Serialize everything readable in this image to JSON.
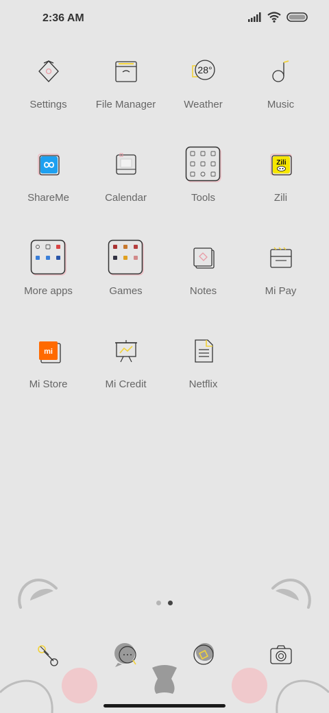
{
  "status_bar": {
    "time": "2:36 AM",
    "icons": [
      "signal-icon",
      "wifi-icon",
      "battery-icon"
    ]
  },
  "apps": [
    {
      "label": "Settings",
      "icon": "settings-icon"
    },
    {
      "label": "File Manager",
      "icon": "file-manager-icon"
    },
    {
      "label": "Weather",
      "icon": "weather-icon",
      "badge": "28°"
    },
    {
      "label": "Music",
      "icon": "music-icon"
    },
    {
      "label": "ShareMe",
      "icon": "shareme-icon"
    },
    {
      "label": "Calendar",
      "icon": "calendar-icon"
    },
    {
      "label": "Tools",
      "icon": "tools-folder-icon"
    },
    {
      "label": "Zili",
      "icon": "zili-icon",
      "badge": "Zili"
    },
    {
      "label": "More apps",
      "icon": "more-apps-folder-icon"
    },
    {
      "label": "Games",
      "icon": "games-folder-icon"
    },
    {
      "label": "Notes",
      "icon": "notes-icon"
    },
    {
      "label": "Mi Pay",
      "icon": "mi-pay-icon"
    },
    {
      "label": "Mi Store",
      "icon": "mi-store-icon",
      "badge": "mi"
    },
    {
      "label": "Mi Credit",
      "icon": "mi-credit-icon"
    },
    {
      "label": "Netflix",
      "icon": "netflix-icon"
    }
  ],
  "pager": {
    "pages": 2,
    "active_index": 1
  },
  "dock": [
    {
      "icon": "phone-icon"
    },
    {
      "icon": "messages-icon"
    },
    {
      "icon": "browser-icon"
    },
    {
      "icon": "camera-icon"
    }
  ],
  "colors": {
    "background": "#e6e6e6",
    "accent_yellow": "#f2d23a",
    "accent_pink": "#f0b9c0",
    "shareme_blue": "#1ea0f0",
    "mi_orange": "#ff6a00"
  }
}
